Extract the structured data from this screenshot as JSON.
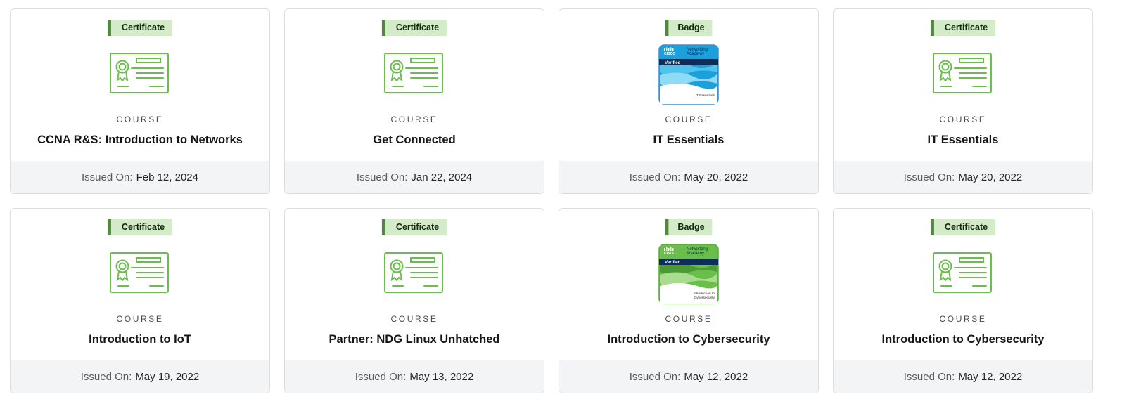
{
  "label_kind": "COURSE",
  "issued_label": "Issued On:",
  "colors": {
    "tag_bg": "#d3ebc9",
    "tag_bar": "#4f8a3c",
    "cert_icon": "#6abf4b",
    "badge_blue": "#1ba0dc",
    "badge_green": "#6abf4b"
  },
  "cards": [
    {
      "tag": "Certificate",
      "icon": "certificate-icon",
      "title": "CCNA R&S: Introduction to Networks",
      "date": "Feb 12, 2024"
    },
    {
      "tag": "Certificate",
      "icon": "certificate-icon",
      "title": "Get Connected",
      "date": "Jan 22, 2024"
    },
    {
      "tag": "Badge",
      "icon": "badge-icon-blue",
      "title": "IT Essentials",
      "date": "May 20, 2022",
      "badge": {
        "line1": "Networking",
        "line2": "Academy",
        "brand": "CISCO",
        "verified": "Verified",
        "caption1": "IT Essentials",
        "caption2": ""
      }
    },
    {
      "tag": "Certificate",
      "icon": "certificate-icon",
      "title": "IT Essentials",
      "date": "May 20, 2022"
    },
    {
      "tag": "Certificate",
      "icon": "certificate-icon",
      "title": "Introduction to IoT",
      "date": "May 19, 2022"
    },
    {
      "tag": "Certificate",
      "icon": "certificate-icon",
      "title": "Partner: NDG Linux Unhatched",
      "date": "May 13, 2022"
    },
    {
      "tag": "Badge",
      "icon": "badge-icon-green",
      "title": "Introduction to Cybersecurity",
      "date": "May 12, 2022",
      "badge": {
        "line1": "Networking",
        "line2": "Academy",
        "brand": "CISCO",
        "verified": "Verified",
        "caption1": "Introduction to",
        "caption2": "Cybersecurity"
      }
    },
    {
      "tag": "Certificate",
      "icon": "certificate-icon",
      "title": "Introduction to Cybersecurity",
      "date": "May 12, 2022"
    }
  ]
}
